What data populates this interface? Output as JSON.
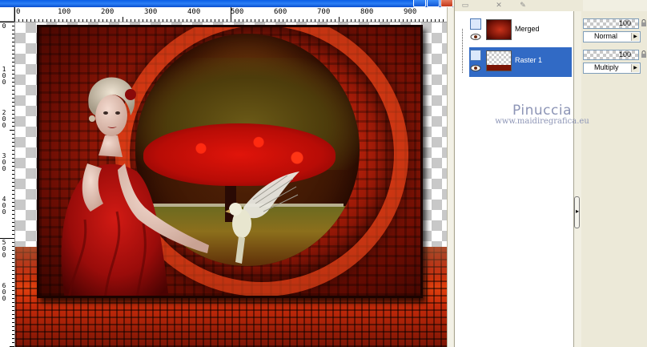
{
  "window": {
    "title": "",
    "buttons": [
      "minimize",
      "maximize",
      "close"
    ]
  },
  "ruler": {
    "horizontal_labels": [
      "0",
      "100",
      "200",
      "300",
      "400",
      "500",
      "600",
      "700",
      "800",
      "900"
    ],
    "vertical_labels": [
      "0",
      "100",
      "200",
      "300",
      "400",
      "500",
      "600"
    ]
  },
  "layers": [
    {
      "name": "Merged",
      "selected": false,
      "visible": true,
      "icon": "raster-layer-icon"
    },
    {
      "name": "Raster 1",
      "selected": true,
      "visible": true,
      "icon": "raster-layer-icon"
    }
  ],
  "layer_props": [
    {
      "opacity": "100",
      "blend_mode": "Normal"
    },
    {
      "opacity": "100",
      "blend_mode": "Multiply"
    }
  ],
  "watermark": {
    "name": "Pinuccia",
    "url": "www.maidiregrafica.eu"
  },
  "colors": {
    "selection": "#316ac5",
    "title_bar": "#0a5ee8",
    "watermark": "#8d95b6"
  }
}
